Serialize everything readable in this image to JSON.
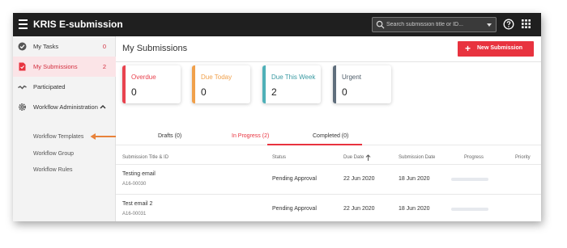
{
  "header": {
    "app_title": "KRIS E-submission",
    "search_placeholder": "Search submission title or ID..."
  },
  "sidebar": {
    "items": [
      {
        "label": "My Tasks",
        "count": "0"
      },
      {
        "label": "My Submissions",
        "count": "2"
      },
      {
        "label": "Participated"
      },
      {
        "label": "Workflow Administration"
      }
    ],
    "sub_items": [
      "Workflow Templates",
      "Workflow Group",
      "Workflow Rules"
    ]
  },
  "main": {
    "title": "My Submissions",
    "new_button_label": "New Submission",
    "cards": [
      {
        "title": "Overdue",
        "value": "0",
        "color": "#e8434f"
      },
      {
        "title": "Due Today",
        "value": "0",
        "color": "#f0a04b"
      },
      {
        "title": "Due This Week",
        "value": "2",
        "color": "#4fb0b8"
      },
      {
        "title": "Urgent",
        "value": "0",
        "color": "#5f6e7c"
      }
    ],
    "tabs": [
      "Drafts (0)",
      "In Progress (2)",
      "Completed (0)"
    ],
    "columns": [
      "Submission Title & ID",
      "Status",
      "Due Date",
      "Submission Date",
      "Progress",
      "Priority"
    ],
    "rows": [
      {
        "title": "Testing email",
        "id": "A16-00030",
        "status": "Pending Approval",
        "due_date": "22 Jun 2020",
        "submission_date": "18 Jun 2020",
        "progress": 0
      },
      {
        "title": "Test email 2",
        "id": "A16-00031",
        "status": "Pending Approval",
        "due_date": "22 Jun 2020",
        "submission_date": "18 Jun 2020",
        "progress": 0
      }
    ]
  },
  "colors": {
    "accent": "#e8333f",
    "topbar": "#1f1f1f",
    "sidebar_active_bg": "#fbe4e7",
    "annotation_arrow": "#e8823a"
  },
  "icons": {
    "menu": "hamburger-icon",
    "search": "search-icon",
    "help": "help-icon",
    "apps": "apps-grid-icon",
    "my_tasks": "check-circle-icon",
    "my_submissions": "document-icon",
    "participated": "handshake-icon",
    "workflow_admin": "gear-icon",
    "sort": "sort-arrow-up-icon",
    "annotation": "arrow-left-icon"
  }
}
